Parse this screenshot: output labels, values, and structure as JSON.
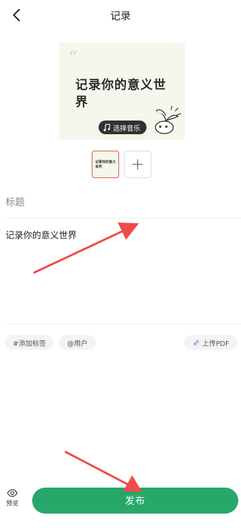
{
  "header": {
    "title": "记录",
    "back_icon": "chevron-left-icon"
  },
  "cover": {
    "quote_mark": "“",
    "text": "记录你的意义世界",
    "music_button_label": "选择音乐",
    "music_icon": "music-note-icon",
    "background_color": "#f5f6ec"
  },
  "thumbnails": {
    "items": [
      {
        "text": "记录你的意义世界",
        "selected": true
      }
    ],
    "add_icon": "plus-icon",
    "selected_border_color": "#e2564f"
  },
  "form": {
    "title_placeholder": "标题",
    "title_value": "",
    "body_text": "记录你的意义世界"
  },
  "chips": {
    "tag_label": "#添加标签",
    "user_label": "@用户",
    "pdf_label": "上传PDF",
    "pdf_icon": "link-icon"
  },
  "bottom": {
    "preview_label": "预览",
    "preview_icon": "eye-icon",
    "publish_label": "发布",
    "publish_color": "#27a86a"
  },
  "annotations": {
    "arrow_color": "#ef4b4b"
  }
}
